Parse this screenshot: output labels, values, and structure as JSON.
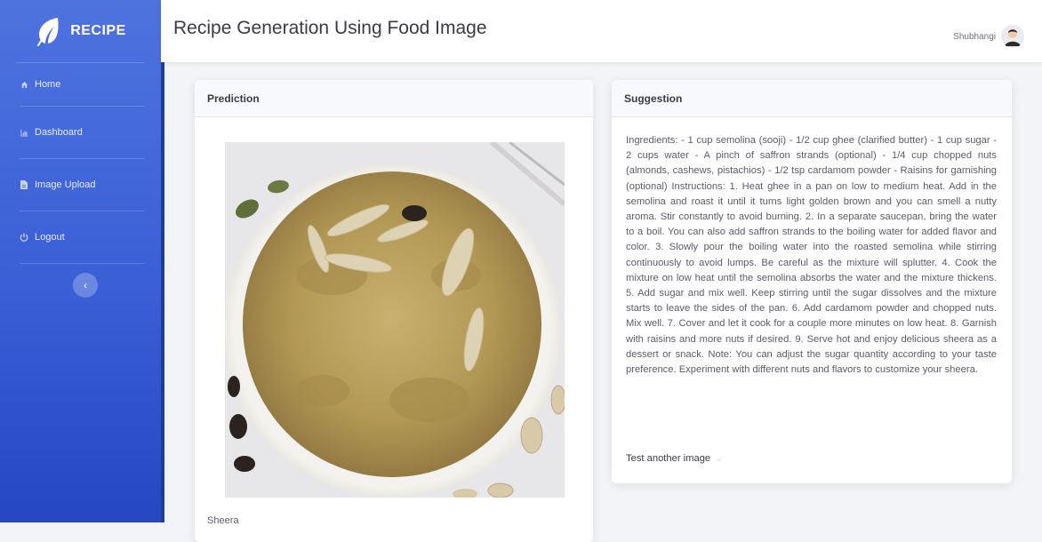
{
  "brand": {
    "name": "RECIPE"
  },
  "sidebar": {
    "items": [
      {
        "label": "Home",
        "icon": "home-icon"
      },
      {
        "label": "Dashboard",
        "icon": "chart-icon"
      },
      {
        "label": "Image Upload",
        "icon": "file-icon"
      },
      {
        "label": "Logout",
        "icon": "power-icon"
      }
    ],
    "toggle": "‹"
  },
  "topbar": {
    "title": "Recipe Generation Using Food Image",
    "user_name": "Shubhangi"
  },
  "prediction": {
    "header": "Prediction",
    "label": "Sheera"
  },
  "suggestion": {
    "header": "Suggestion",
    "text": "Ingredients: - 1 cup semolina (sooji) - 1/2 cup ghee (clarified butter) - 1 cup sugar - 2 cups water - A pinch of saffron strands (optional) - 1/4 cup chopped nuts (almonds, cashews, pistachios) - 1/2 tsp cardamom powder - Raisins for garnishing (optional) Instructions: 1. Heat ghee in a pan on low to medium heat. Add in the semolina and roast it until it turns light golden brown and you can smell a nutty aroma. Stir constantly to avoid burning. 2. In a separate saucepan, bring the water to a boil. You can also add saffron strands to the boiling water for added flavor and color. 3. Slowly pour the boiling water into the roasted semolina while stirring continuously to avoid lumps. Be careful as the mixture will splutter. 4. Cook the mixture on low heat until the semolina absorbs the water and the mixture thickens. 5. Add sugar and mix well. Keep stirring until the sugar dissolves and the mixture starts to leave the sides of the pan. 6. Add cardamom powder and chopped nuts. Mix well. 7. Cover and let it cook for a couple more minutes on low heat. 8. Garnish with raisins and more nuts if desired. 9. Serve hot and enjoy delicious sheera as a dessert or snack. Note: You can adjust the sugar quantity according to your taste preference. Experiment with different nuts and flavors to customize your sheera.",
    "link": "Test another image",
    "link_arrow": "→"
  },
  "colors": {
    "sidebar": "#4e73df",
    "sidebar_dark": "#2547c2",
    "text": "#5a5c69"
  }
}
